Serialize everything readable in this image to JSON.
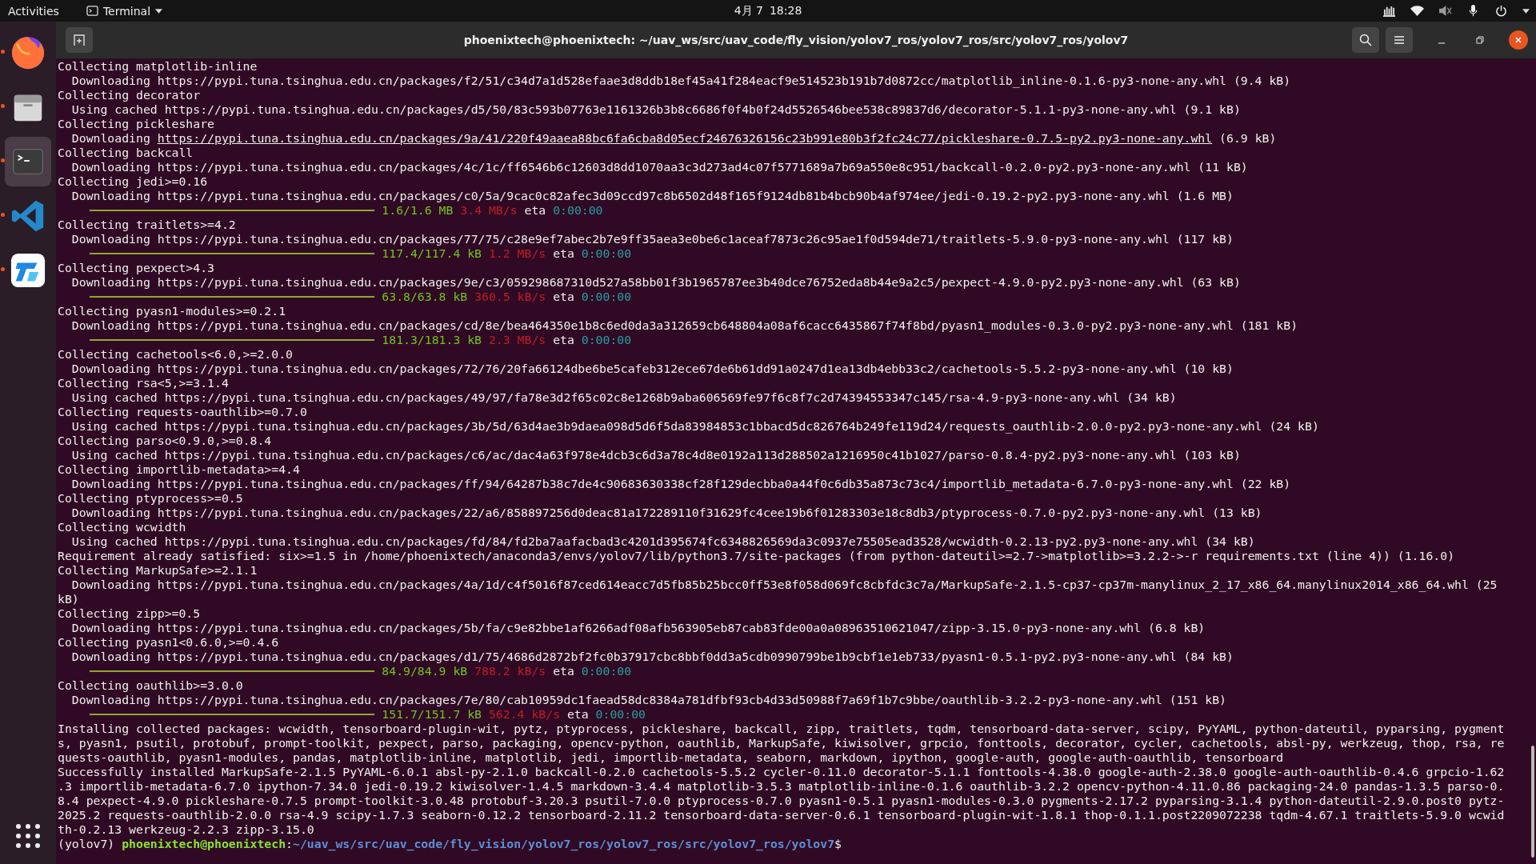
{
  "top_bar": {
    "activities": "Activities",
    "app_menu": "Terminal",
    "date": "4月 7",
    "time": "18:28"
  },
  "dock": {
    "items": [
      {
        "kind": "firefox",
        "running": true,
        "selected": false
      },
      {
        "kind": "files",
        "running": true,
        "selected": false
      },
      {
        "kind": "terminal",
        "running": true,
        "selected": true
      },
      {
        "kind": "code",
        "running": true,
        "selected": false
      },
      {
        "kind": "app",
        "running": true,
        "selected": false
      }
    ]
  },
  "window": {
    "title": "phoenixtech@phoenixtech: ~/uav_ws/src/uav_code/fly_vision/yolov7_ros/yolov7_ros/src/yolov7_ros/yolov7"
  },
  "terminal": {
    "lines": [
      {
        "kind": "text",
        "text": "Collecting matplotlib-inline"
      },
      {
        "kind": "text",
        "text": "  Downloading https://pypi.tuna.tsinghua.edu.cn/packages/f2/51/c34d7a1d528efaae3d8ddb18ef45a41f284eacf9e514523b191b7d0872cc/matplotlib_inline-0.1.6-py3-none-any.whl (9.4 kB)"
      },
      {
        "kind": "text",
        "text": "Collecting decorator"
      },
      {
        "kind": "text",
        "text": "  Using cached https://pypi.tuna.tsinghua.edu.cn/packages/d5/50/83c593b07763e1161326b3b8c6686f0f4b0f24d5526546bee538c89837d6/decorator-5.1.1-py3-none-any.whl (9.1 kB)"
      },
      {
        "kind": "text",
        "text": "Collecting pickleshare"
      },
      {
        "kind": "link",
        "prefix": "  Downloading ",
        "url": "https://pypi.tuna.tsinghua.edu.cn/packages/9a/41/220f49aaea88bc6fa6cba8d05ecf24676326156c23b991e80b3f2fc24c77/pickleshare-0.7.5-py2.py3-none-any.whl",
        "suffix": " (6.9 kB)"
      },
      {
        "kind": "text",
        "text": "Collecting backcall"
      },
      {
        "kind": "text",
        "text": "  Downloading https://pypi.tuna.tsinghua.edu.cn/packages/4c/1c/ff6546b6c12603d8dd1070aa3c3d273ad4c07f5771689a7b69a550e8c951/backcall-0.2.0-py2.py3-none-any.whl (11 kB)"
      },
      {
        "kind": "text",
        "text": "Collecting jedi>=0.16"
      },
      {
        "kind": "text",
        "text": "  Downloading https://pypi.tuna.tsinghua.edu.cn/packages/c0/5a/9cac0c82afec3d09ccd97c8b6502d48f165f9124db81b4bcb90b4af974ee/jedi-0.19.2-py2.py3-none-any.whl (1.6 MB)"
      },
      {
        "kind": "progress",
        "level": 1,
        "size": "1.6/1.6 MB",
        "speed": "3.4 MB/s",
        "eta_label": "eta",
        "eta": "0:00:00"
      },
      {
        "kind": "text",
        "text": "Collecting traitlets>=4.2"
      },
      {
        "kind": "text",
        "text": "  Downloading https://pypi.tuna.tsinghua.edu.cn/packages/77/75/c28e9ef7abec2b7e9ff35aea3e0be6c1aceaf7873c26c95ae1f0d594de71/traitlets-5.9.0-py3-none-any.whl (117 kB)"
      },
      {
        "kind": "progress",
        "level": 1,
        "size": "117.4/117.4 kB",
        "speed": "1.2 MB/s",
        "eta_label": "eta",
        "eta": "0:00:00"
      },
      {
        "kind": "text",
        "text": "Collecting pexpect>4.3"
      },
      {
        "kind": "text",
        "text": "  Downloading https://pypi.tuna.tsinghua.edu.cn/packages/9e/c3/059298687310d527a58bb01f3b1965787ee3b40dce76752eda8b44e9a2c5/pexpect-4.9.0-py2.py3-none-any.whl (63 kB)"
      },
      {
        "kind": "progress",
        "level": 1,
        "size": "63.8/63.8 kB",
        "speed": "360.5 kB/s",
        "eta_label": "eta",
        "eta": "0:00:00"
      },
      {
        "kind": "text",
        "text": "Collecting pyasn1-modules>=0.2.1"
      },
      {
        "kind": "text",
        "text": "  Downloading https://pypi.tuna.tsinghua.edu.cn/packages/cd/8e/bea464350e1b8c6ed0da3a312659cb648804a08af6cacc6435867f74f8bd/pyasn1_modules-0.3.0-py2.py3-none-any.whl (181 kB)"
      },
      {
        "kind": "progress",
        "level": 1,
        "size": "181.3/181.3 kB",
        "speed": "2.3 MB/s",
        "eta_label": "eta",
        "eta": "0:00:00"
      },
      {
        "kind": "text",
        "text": "Collecting cachetools<6.0,>=2.0.0"
      },
      {
        "kind": "text",
        "text": "  Downloading https://pypi.tuna.tsinghua.edu.cn/packages/72/76/20fa66124dbe6be5cafeb312ece67de6b61dd91a0247d1ea13db4ebb33c2/cachetools-5.5.2-py3-none-any.whl (10 kB)"
      },
      {
        "kind": "text",
        "text": "Collecting rsa<5,>=3.1.4"
      },
      {
        "kind": "text",
        "text": "  Using cached https://pypi.tuna.tsinghua.edu.cn/packages/49/97/fa78e3d2f65c02c8e1268b9aba606569fe97f6c8f7c2d74394553347c145/rsa-4.9-py3-none-any.whl (34 kB)"
      },
      {
        "kind": "text",
        "text": "Collecting requests-oauthlib>=0.7.0"
      },
      {
        "kind": "text",
        "text": "  Using cached https://pypi.tuna.tsinghua.edu.cn/packages/3b/5d/63d4ae3b9daea098d5d6f5da83984853c1bbacd5dc826764b249fe119d24/requests_oauthlib-2.0.0-py2.py3-none-any.whl (24 kB)"
      },
      {
        "kind": "text",
        "text": "Collecting parso<0.9.0,>=0.8.4"
      },
      {
        "kind": "text",
        "text": "  Using cached https://pypi.tuna.tsinghua.edu.cn/packages/c6/ac/dac4a63f978e4dcb3c6d3a78c4d8e0192a113d288502a1216950c41b1027/parso-0.8.4-py2.py3-none-any.whl (103 kB)"
      },
      {
        "kind": "text",
        "text": "Collecting importlib-metadata>=4.4"
      },
      {
        "kind": "text",
        "text": "  Downloading https://pypi.tuna.tsinghua.edu.cn/packages/ff/94/64287b38c7de4c90683630338cf28f129decbba0a44f0c6db35a873c73c4/importlib_metadata-6.7.0-py3-none-any.whl (22 kB)"
      },
      {
        "kind": "text",
        "text": "Collecting ptyprocess>=0.5"
      },
      {
        "kind": "text",
        "text": "  Downloading https://pypi.tuna.tsinghua.edu.cn/packages/22/a6/858897256d0deac81a172289110f31629fc4cee19b6f01283303e18c8db3/ptyprocess-0.7.0-py2.py3-none-any.whl (13 kB)"
      },
      {
        "kind": "text",
        "text": "Collecting wcwidth"
      },
      {
        "kind": "text",
        "text": "  Using cached https://pypi.tuna.tsinghua.edu.cn/packages/fd/84/fd2ba7aafacbad3c4201d395674fc6348826569da3c0937e75505ead3528/wcwidth-0.2.13-py2.py3-none-any.whl (34 kB)"
      },
      {
        "kind": "text",
        "text": "Requirement already satisfied: six>=1.5 in /home/phoenixtech/anaconda3/envs/yolov7/lib/python3.7/site-packages (from python-dateutil>=2.7->matplotlib>=3.2.2->-r requirements.txt (line 4)) (1.16.0)"
      },
      {
        "kind": "text",
        "text": "Collecting MarkupSafe>=2.1.1"
      },
      {
        "kind": "text",
        "text": "  Downloading https://pypi.tuna.tsinghua.edu.cn/packages/4a/1d/c4f5016f87ced614eacc7d5fb85b25bcc0ff53e8f058d069fc8cbfdc3c7a/MarkupSafe-2.1.5-cp37-cp37m-manylinux_2_17_x86_64.manylinux2014_x86_64.whl (25"
      },
      {
        "kind": "text",
        "text": "kB)"
      },
      {
        "kind": "text",
        "text": "Collecting zipp>=0.5"
      },
      {
        "kind": "text",
        "text": "  Downloading https://pypi.tuna.tsinghua.edu.cn/packages/5b/fa/c9e82bbe1af6266adf08afb563905eb87cab83fde00a0a08963510621047/zipp-3.15.0-py3-none-any.whl (6.8 kB)"
      },
      {
        "kind": "text",
        "text": "Collecting pyasn1<0.6.0,>=0.4.6"
      },
      {
        "kind": "text",
        "text": "  Downloading https://pypi.tuna.tsinghua.edu.cn/packages/d1/75/4686d2872bf2fc0b37917cbc8bbf0dd3a5cdb0990799be1b9cbf1e1eb733/pyasn1-0.5.1-py2.py3-none-any.whl (84 kB)"
      },
      {
        "kind": "progress",
        "level": 1,
        "size": "84.9/84.9 kB",
        "speed": "788.2 kB/s",
        "eta_label": "eta",
        "eta": "0:00:00"
      },
      {
        "kind": "text",
        "text": "Collecting oauthlib>=3.0.0"
      },
      {
        "kind": "text",
        "text": "  Downloading https://pypi.tuna.tsinghua.edu.cn/packages/7e/80/cab10959dc1faead58dc8384a781dfbf93cb4d33d50988f7a69f1b7c9bbe/oauthlib-3.2.2-py3-none-any.whl (151 kB)"
      },
      {
        "kind": "progress",
        "level": 1,
        "size": "151.7/151.7 kB",
        "speed": "562.4 kB/s",
        "eta_label": "eta",
        "eta": "0:00:00"
      },
      {
        "kind": "text",
        "text": "Installing collected packages: wcwidth, tensorboard-plugin-wit, pytz, ptyprocess, pickleshare, backcall, zipp, traitlets, tqdm, tensorboard-data-server, scipy, PyYAML, python-dateutil, pyparsing, pygment"
      },
      {
        "kind": "text",
        "text": "s, pyasn1, psutil, protobuf, prompt-toolkit, pexpect, parso, packaging, opencv-python, oauthlib, MarkupSafe, kiwisolver, grpcio, fonttools, decorator, cycler, cachetools, absl-py, werkzeug, thop, rsa, re"
      },
      {
        "kind": "text",
        "text": "quests-oauthlib, pyasn1-modules, pandas, matplotlib-inline, matplotlib, jedi, importlib-metadata, seaborn, markdown, ipython, google-auth, google-auth-oauthlib, tensorboard"
      },
      {
        "kind": "text",
        "text": "Successfully installed MarkupSafe-2.1.5 PyYAML-6.0.1 absl-py-2.1.0 backcall-0.2.0 cachetools-5.5.2 cycler-0.11.0 decorator-5.1.1 fonttools-4.38.0 google-auth-2.38.0 google-auth-oauthlib-0.4.6 grpcio-1.62"
      },
      {
        "kind": "text",
        "text": ".3 importlib-metadata-6.7.0 ipython-7.34.0 jedi-0.19.2 kiwisolver-1.4.5 markdown-3.4.4 matplotlib-3.5.3 matplotlib-inline-0.1.6 oauthlib-3.2.2 opencv-python-4.11.0.86 packaging-24.0 pandas-1.3.5 parso-0."
      },
      {
        "kind": "text",
        "text": "8.4 pexpect-4.9.0 pickleshare-0.7.5 prompt-toolkit-3.0.48 protobuf-3.20.3 psutil-7.0.0 ptyprocess-0.7.0 pyasn1-0.5.1 pyasn1-modules-0.3.0 pygments-2.17.2 pyparsing-3.1.4 python-dateutil-2.9.0.post0 pytz-"
      },
      {
        "kind": "text",
        "text": "2025.2 requests-oauthlib-2.0.0 rsa-4.9 scipy-1.7.3 seaborn-0.12.2 tensorboard-2.11.2 tensorboard-data-server-0.6.1 tensorboard-plugin-wit-1.8.1 thop-0.1.1.post2209072238 tqdm-4.67.1 traitlets-5.9.0 wcwid"
      },
      {
        "kind": "text",
        "text": "th-0.2.13 werkzeug-2.2.3 zipp-3.15.0"
      },
      {
        "kind": "prompt",
        "env": "(yolov7)",
        "user": "phoenixtech@phoenixtech",
        "separator": ":",
        "path": "~/uav_ws/src/uav_code/fly_vision/yolov7_ros/yolov7_ros/src/yolov7_ros/yolov7",
        "symbol": "$"
      }
    ]
  }
}
